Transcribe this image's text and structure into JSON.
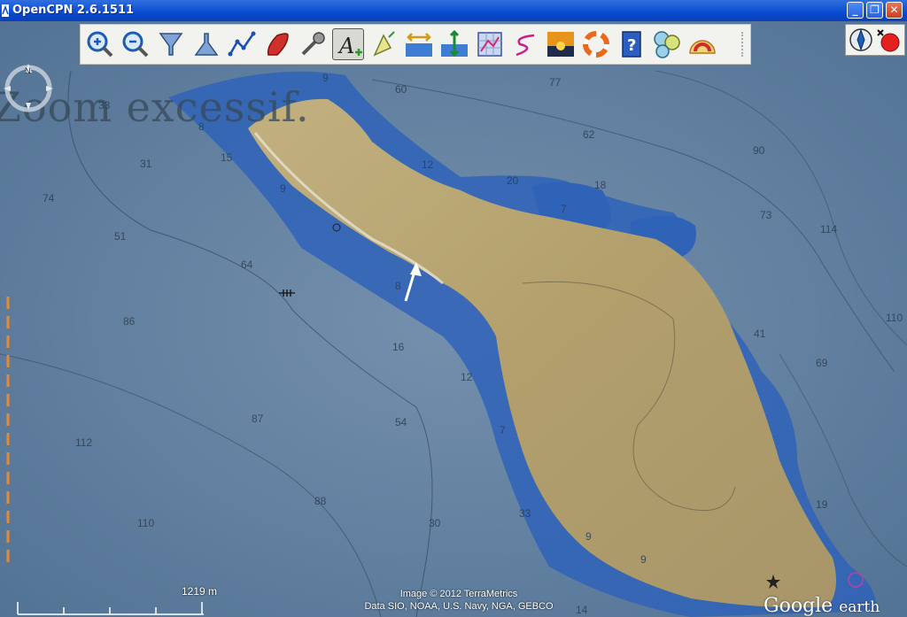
{
  "window": {
    "title": "OpenCPN 2.6.1511"
  },
  "window_controls": {
    "minimize": "_",
    "maximize": "❐",
    "close": "✕"
  },
  "toolbar": {
    "tools": [
      {
        "name": "zoom-in",
        "icon": "zoom-in-icon"
      },
      {
        "name": "zoom-out",
        "icon": "zoom-out-icon"
      },
      {
        "name": "scale-in",
        "icon": "funnel-down-icon"
      },
      {
        "name": "scale-out",
        "icon": "funnel-up-icon"
      },
      {
        "name": "create-route",
        "icon": "route-icon"
      },
      {
        "name": "auto-follow",
        "icon": "ship-icon"
      },
      {
        "name": "toolbox",
        "icon": "wrench-icon"
      },
      {
        "name": "text",
        "icon": "text-a-icon",
        "active": true
      },
      {
        "name": "current",
        "icon": "current-arrows-icon"
      },
      {
        "name": "tide",
        "icon": "tide-icon"
      },
      {
        "name": "current-stream",
        "icon": "stream-icon"
      },
      {
        "name": "route-manager",
        "icon": "chart-grid-icon"
      },
      {
        "name": "track",
        "icon": "track-icon"
      },
      {
        "name": "color-scheme",
        "icon": "sunset-icon"
      },
      {
        "name": "man-overboard",
        "icon": "lifebuoy-icon"
      },
      {
        "name": "help",
        "icon": "help-book-icon"
      },
      {
        "name": "gps-status",
        "icon": "gauges-icon"
      },
      {
        "name": "settings",
        "icon": "life-raft-icon"
      }
    ]
  },
  "overlay_text": {
    "zoom_warning": "Zoom excessif."
  },
  "depth_soundings": [
    "33",
    "9",
    "60",
    "77",
    "8",
    "62",
    "90",
    "31",
    "15",
    "9",
    "12",
    "20",
    "18",
    "74",
    "7",
    "73",
    "114",
    "51",
    "64",
    "8",
    "110",
    "86",
    "41",
    "16",
    "69",
    "12",
    "87",
    "54",
    "7",
    "112",
    "88",
    "33",
    "30",
    "110",
    "9",
    "19",
    "9",
    "14"
  ],
  "scale_bar": {
    "label": "1219 m"
  },
  "credits": {
    "line1": "Image © 2012 TerraMetrics",
    "line2": "Data SIO, NOAA, U.S. Navy, NGA, GEBCO"
  },
  "google_logo": {
    "main": "Google",
    "sub": "earth"
  },
  "colors": {
    "titlebar": "#0a4bd0",
    "toolbar": "#f2f2ee",
    "sea": "#5f7f9e",
    "shallow": "#2f63b8",
    "land": "#b6a373"
  }
}
